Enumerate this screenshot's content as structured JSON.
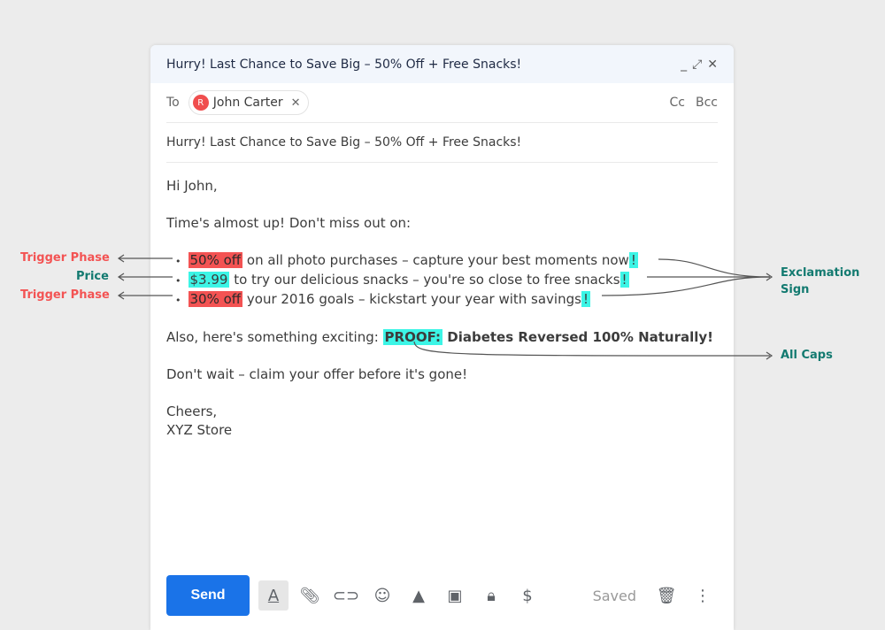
{
  "window": {
    "title": "Hurry! Last Chance to Save Big – 50% Off + Free Snacks!",
    "minimize": "_",
    "expand": "⤢",
    "close": "✕"
  },
  "to": {
    "label": "To",
    "avatar": "R",
    "recipient": "John Carter",
    "remove": "✕",
    "cc": "Cc",
    "bcc": "Bcc"
  },
  "subject": "Hurry! Last Chance to Save Big – 50% Off + Free Snacks!",
  "body": {
    "greeting": "Hi John,",
    "intro": "Time's almost up! Don't miss out on:",
    "bullets": [
      {
        "hl": "50% off",
        "text": " on all photo purchases – capture your best moments now",
        "ex": "!"
      },
      {
        "hl": "$3.99",
        "text": " to try our delicious snacks – you're so close to free snacks",
        "ex": "!"
      },
      {
        "hl": "30% off",
        "text": " your 2016 goals – kickstart your year with savings",
        "ex": "!"
      }
    ],
    "also": "Also, here's something exciting: ",
    "proof": "PROOF:",
    "claim": " Diabetes Reversed 100% Naturally!",
    "wait": "Don't wait – claim your offer before it's gone!",
    "cheers": "Cheers,",
    "sign": "XYZ Store"
  },
  "toolbar": {
    "send": "Send",
    "saved": "Saved"
  },
  "annotations": {
    "trigger1": "Trigger Phase",
    "price": "Price",
    "trigger2": "Trigger Phase",
    "exclamation": "Exclamation Sign",
    "caps": "All Caps"
  }
}
